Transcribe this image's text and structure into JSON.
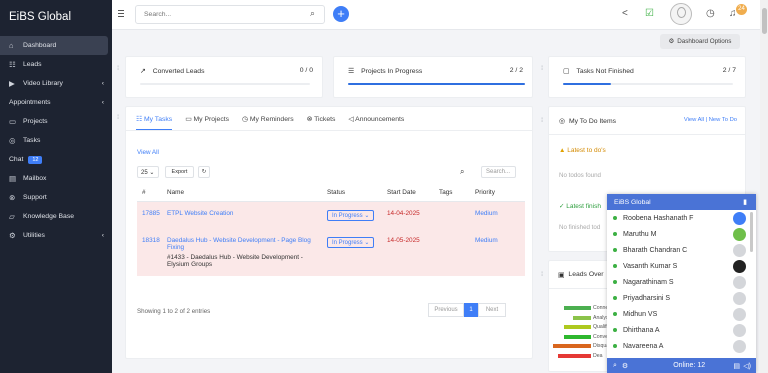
{
  "sidebar": {
    "brand": "EiBS Global",
    "items": [
      {
        "label": "Dashboard",
        "icon": "home-icon",
        "active": true
      },
      {
        "label": "Leads",
        "icon": "leads-icon"
      },
      {
        "label": "Video Library",
        "icon": "video-icon",
        "chevron": true
      }
    ],
    "section1": "Appointments",
    "items2": [
      {
        "label": "Projects",
        "icon": "projects-icon"
      },
      {
        "label": "Tasks",
        "icon": "tasks-icon"
      }
    ],
    "chat_label": "Chat",
    "chat_badge": "12",
    "items3": [
      {
        "label": "Mailbox"
      },
      {
        "label": "Support"
      },
      {
        "label": "Knowledge Base"
      },
      {
        "label": "Utilities"
      }
    ]
  },
  "topbar": {
    "search_placeholder": "Search...",
    "notif_count": "24"
  },
  "dashboard_options": "Dashboard Options",
  "stats": [
    {
      "label": "Converted Leads",
      "value": "0 / 0",
      "progress": 0
    },
    {
      "label": "Projects In Progress",
      "value": "2 / 2",
      "progress": 100
    },
    {
      "label": "Tasks Not Finished",
      "value": "2 / 7",
      "progress": 28
    }
  ],
  "tabs": [
    "My Tasks",
    "My Projects",
    "My Reminders",
    "Tickets",
    "Announcements"
  ],
  "tasks": {
    "view_all": "View All",
    "page_size": "25",
    "export": "Export",
    "search_placeholder": "Search...",
    "columns": [
      "#",
      "Name",
      "Status",
      "Start Date",
      "Tags",
      "Priority"
    ],
    "rows": [
      {
        "id": "17885",
        "name": "ETPL Website Creation",
        "sub": "",
        "status": "In Progress",
        "date": "14-04-2025",
        "tags": "",
        "priority": "Medium"
      },
      {
        "id": "18318",
        "name": "Daedalus Hub - Website Development - Page Blog Fixing",
        "sub": "#1433 - Daedalus Hub - Website Development - Elysium Groups",
        "status": "In Progress",
        "date": "14-05-2025",
        "tags": "",
        "priority": "Medium"
      }
    ],
    "footer": "Showing 1 to 2 of 2 entries",
    "prev": "Previous",
    "page": "1",
    "next": "Next"
  },
  "todo": {
    "title": "My To Do Items",
    "view_all": "View All",
    "new": "New To Do",
    "latest": "Latest to do's",
    "no_todos": "No todos found",
    "latest_finished": "Latest finish",
    "no_finished": "No finished tod"
  },
  "leads_overview": {
    "title": "Leads Over"
  },
  "chart_data": {
    "type": "bar",
    "categories": [
      "Connect",
      "Analysis",
      "Qualified",
      "Conve",
      "Disqualified",
      "Dea"
    ],
    "values": [
      27,
      18,
      27,
      27,
      38,
      33
    ],
    "colors": [
      "#4caf50",
      "#8bc34a",
      "#aec91f",
      "#2eb82e",
      "#d9661e",
      "#e53935"
    ]
  },
  "chat": {
    "title": "EiBS Global",
    "users": [
      "Roobena Hashanath F",
      "Maruthu M",
      "Bharath Chandran C",
      "Vasanth Kumar S",
      "Nagarathinam S",
      "Priyadharsini S",
      "Midhun VS",
      "Dhirthana A",
      "Navareena A"
    ],
    "online": "Online: 12"
  }
}
